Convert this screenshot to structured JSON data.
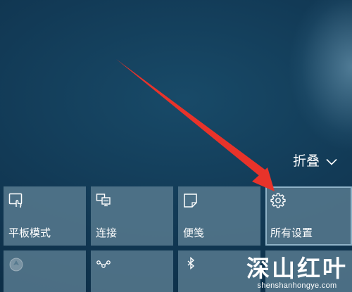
{
  "action_center": {
    "collapse_label": "折叠",
    "collapse_icon": "chevron-down-icon",
    "tiles": [
      {
        "label": "平板模式",
        "icon": "tablet-mode-icon"
      },
      {
        "label": "连接",
        "icon": "connect-icon"
      },
      {
        "label": "便笺",
        "icon": "note-icon"
      },
      {
        "label": "所有设置",
        "icon": "gear-icon"
      },
      {
        "label": "",
        "icon": "location-icon"
      },
      {
        "label": "",
        "icon": "vpn-icon"
      },
      {
        "label": "",
        "icon": "bluetooth-icon"
      },
      {
        "label": "",
        "icon": "network-icon"
      }
    ]
  },
  "annotation": {
    "type": "red-arrow",
    "color": "#e8332a",
    "points_to": "所有设置"
  },
  "watermark": {
    "title": "深山红叶",
    "url": "shenshanhongye.com"
  },
  "colors": {
    "background": "#143f5c",
    "tile": "#56798e",
    "text": "#ffffff",
    "arrow": "#e8332a"
  }
}
